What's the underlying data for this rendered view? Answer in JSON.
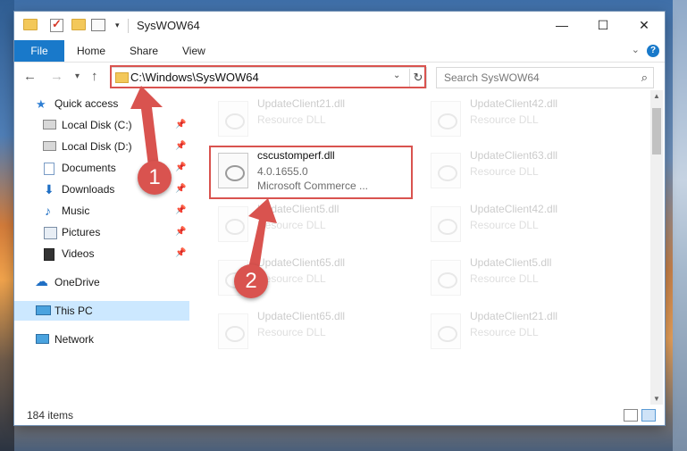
{
  "window": {
    "title": "SysWOW64",
    "controls": {
      "minimize": "—",
      "maximize": "☐",
      "close": "✕"
    }
  },
  "ribbon": {
    "tabs": [
      "File",
      "Home",
      "Share",
      "View"
    ],
    "help": "?"
  },
  "address": {
    "path": "C:\\Windows\\SysWOW64",
    "refresh_icon": "↻"
  },
  "search": {
    "placeholder": "Search SysWOW64",
    "icon": "⌕"
  },
  "nav": {
    "items": [
      {
        "label": "Quick access",
        "icon": "star-icon"
      },
      {
        "label": "Local Disk (C:)",
        "icon": "drive-icon"
      },
      {
        "label": "Local Disk (D:)",
        "icon": "drive-icon"
      },
      {
        "label": "Documents",
        "icon": "documents-icon"
      },
      {
        "label": "Downloads",
        "icon": "downloads-icon"
      },
      {
        "label": "Music",
        "icon": "music-icon"
      },
      {
        "label": "Pictures",
        "icon": "pictures-icon"
      },
      {
        "label": "Videos",
        "icon": "videos-icon"
      },
      {
        "label": "OneDrive",
        "icon": "cloud-icon"
      },
      {
        "label": "This PC",
        "icon": "computer-icon"
      },
      {
        "label": "Network",
        "icon": "network-icon"
      }
    ]
  },
  "files": {
    "highlighted": {
      "name": "cscustomperf.dll",
      "version": "4.0.1655.0",
      "description": "Microsoft Commerce ..."
    },
    "faded": [
      {
        "name": "UpdateClient21.dll",
        "type": "Resource DLL"
      },
      {
        "name": "UpdateClient42.dll",
        "type": "Resource DLL"
      },
      {
        "name": "UpdateClient63.dll",
        "type": "Resource DLL"
      },
      {
        "name": "UpdateClient5.dll",
        "type": "Resource DLL"
      },
      {
        "name": "UpdateClient42.dll",
        "type": "Resource DLL"
      },
      {
        "name": "UpdateClient65.dll",
        "type": "Resource DLL"
      },
      {
        "name": "UpdateClient5.dll",
        "type": "Resource DLL"
      },
      {
        "name": "UpdateClient65.dll",
        "type": "Resource DLL"
      },
      {
        "name": "UpdateClient21.dll",
        "type": "Resource DLL"
      }
    ]
  },
  "status": {
    "item_count": "184 items"
  },
  "callouts": [
    "1",
    "2"
  ],
  "colors": {
    "accent": "#1979ca",
    "highlight": "#d9534f",
    "selection": "#cce8ff"
  }
}
